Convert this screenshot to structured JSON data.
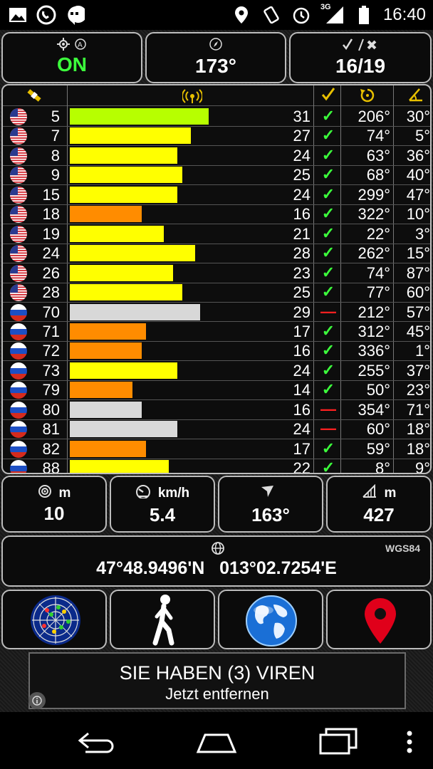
{
  "status_bar": {
    "time": "16:40",
    "network": "3G",
    "left_icons": [
      "gallery-icon",
      "whatsapp-icon",
      "hangouts-icon"
    ],
    "right_icons": [
      "location-icon",
      "vibrate-icon",
      "alarm-icon",
      "signal-icon",
      "battery-icon"
    ]
  },
  "top": {
    "gps_status": "ON",
    "heading": "173°",
    "sats_used_visible": "16/19"
  },
  "satellites": [
    {
      "country": "us",
      "prn": "5",
      "snr": "31",
      "level": 31,
      "color": "#b7ff00",
      "used": "✓",
      "az": "206°",
      "el": "30°"
    },
    {
      "country": "us",
      "prn": "7",
      "snr": "27",
      "level": 27,
      "color": "#ffff00",
      "used": "✓",
      "az": "74°",
      "el": "5°"
    },
    {
      "country": "us",
      "prn": "8",
      "snr": "24",
      "level": 24,
      "color": "#ffff00",
      "used": "✓",
      "az": "63°",
      "el": "36°"
    },
    {
      "country": "us",
      "prn": "9",
      "snr": "25",
      "level": 25,
      "color": "#ffff00",
      "used": "✓",
      "az": "68°",
      "el": "40°"
    },
    {
      "country": "us",
      "prn": "15",
      "snr": "24",
      "level": 24,
      "color": "#ffff00",
      "used": "✓",
      "az": "299°",
      "el": "47°"
    },
    {
      "country": "us",
      "prn": "18",
      "snr": "16",
      "level": 16,
      "color": "#ff8c00",
      "used": "✓",
      "az": "322°",
      "el": "10°"
    },
    {
      "country": "us",
      "prn": "19",
      "snr": "21",
      "level": 21,
      "color": "#ffff00",
      "used": "✓",
      "az": "22°",
      "el": "3°"
    },
    {
      "country": "us",
      "prn": "24",
      "snr": "28",
      "level": 28,
      "color": "#ffff00",
      "used": "✓",
      "az": "262°",
      "el": "15°"
    },
    {
      "country": "us",
      "prn": "26",
      "snr": "23",
      "level": 23,
      "color": "#ffff00",
      "used": "✓",
      "az": "74°",
      "el": "87°"
    },
    {
      "country": "us",
      "prn": "28",
      "snr": "25",
      "level": 25,
      "color": "#ffff00",
      "used": "✓",
      "az": "77°",
      "el": "60°"
    },
    {
      "country": "ru",
      "prn": "70",
      "snr": "29",
      "level": 29,
      "color": "#d8d8d8",
      "used": "—",
      "az": "212°",
      "el": "57°"
    },
    {
      "country": "ru",
      "prn": "71",
      "snr": "17",
      "level": 17,
      "color": "#ff8c00",
      "used": "✓",
      "az": "312°",
      "el": "45°"
    },
    {
      "country": "ru",
      "prn": "72",
      "snr": "16",
      "level": 16,
      "color": "#ff8c00",
      "used": "✓",
      "az": "336°",
      "el": "1°"
    },
    {
      "country": "ru",
      "prn": "73",
      "snr": "24",
      "level": 24,
      "color": "#ffff00",
      "used": "✓",
      "az": "255°",
      "el": "37°"
    },
    {
      "country": "ru",
      "prn": "79",
      "snr": "14",
      "level": 14,
      "color": "#ff8c00",
      "used": "✓",
      "az": "50°",
      "el": "23°"
    },
    {
      "country": "ru",
      "prn": "80",
      "snr": "16",
      "level": 16,
      "color": "#d8d8d8",
      "used": "—",
      "az": "354°",
      "el": "71°"
    },
    {
      "country": "ru",
      "prn": "81",
      "snr": "24",
      "level": 24,
      "color": "#d8d8d8",
      "used": "—",
      "az": "60°",
      "el": "18°"
    },
    {
      "country": "ru",
      "prn": "82",
      "snr": "17",
      "level": 17,
      "color": "#ff8c00",
      "used": "✓",
      "az": "59°",
      "el": "18°"
    },
    {
      "country": "ru",
      "prn": "88",
      "snr": "22",
      "level": 22,
      "color": "#ffff00",
      "used": "✓",
      "az": "8°",
      "el": "9°"
    }
  ],
  "info": {
    "accuracy": {
      "unit": "m",
      "value": "10"
    },
    "speed": {
      "unit": "km/h",
      "value": "5.4"
    },
    "bearing": {
      "unit": "",
      "value": "163°"
    },
    "altitude": {
      "unit": "m",
      "value": "427"
    }
  },
  "coords": {
    "datum": "WGS84",
    "text": "47°48.9496'N   013°02.7254'E"
  },
  "tools": [
    "radar-button",
    "walk-button",
    "globe-button",
    "map-pin-button"
  ],
  "ad": {
    "line1": "SIE HABEN (3) VIREN",
    "line2": "Jetzt entfernen"
  },
  "colors": {
    "on_green": "#3cff3c",
    "check_green": "#3cff3c",
    "dash_red": "#ff2020"
  }
}
